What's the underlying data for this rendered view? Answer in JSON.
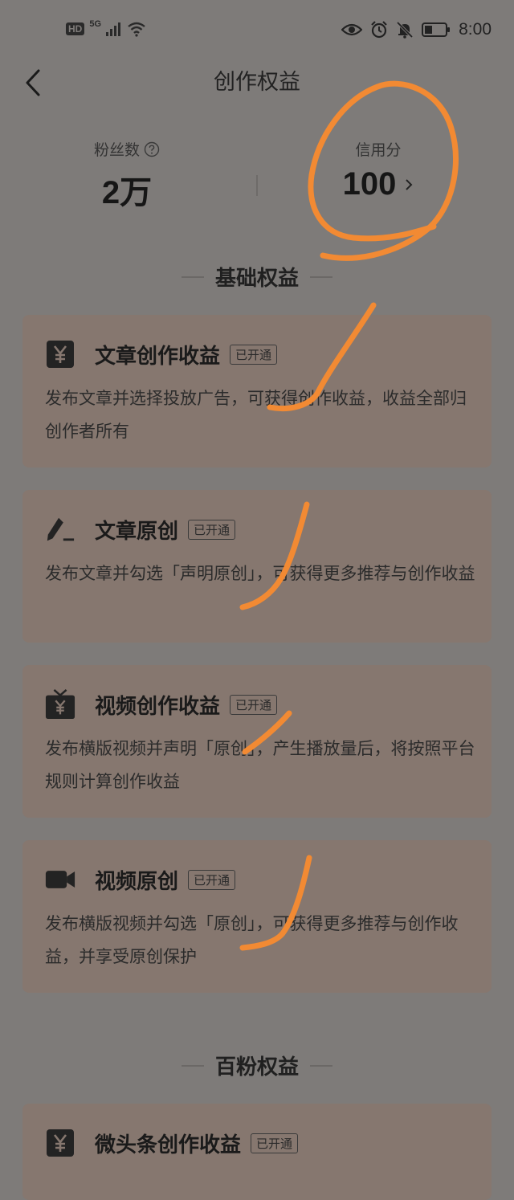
{
  "status_bar": {
    "hd": "HD",
    "signal": "5G",
    "time": "8:00"
  },
  "header": {
    "title": "创作权益"
  },
  "stats": {
    "fans": {
      "label": "粉丝数",
      "value": "2万"
    },
    "credit": {
      "label": "信用分",
      "value": "100"
    }
  },
  "sections": {
    "basic": {
      "title": "基础权益"
    },
    "hundred": {
      "title": "百粉权益"
    }
  },
  "cards": [
    {
      "title": "文章创作收益",
      "badge": "已开通",
      "desc": "发布文章并选择投放广告，可获得创作收益，收益全部归创作者所有"
    },
    {
      "title": "文章原创",
      "badge": "已开通",
      "desc": "发布文章并勾选「声明原创」，可获得更多推荐与创作收益"
    },
    {
      "title": "视频创作收益",
      "badge": "已开通",
      "desc": "发布横版视频并声明「原创」，产生播放量后，将按照平台规则计算创作收益"
    },
    {
      "title": "视频原创",
      "badge": "已开通",
      "desc": "发布横版视频并勾选「原创」，可获得更多推荐与创作收益，并享受原创保护"
    },
    {
      "title": "微头条创作收益",
      "badge": "已开通"
    }
  ],
  "icons": {
    "fans_help": "question-circle-icon",
    "credit_arrow": "chevron-right-icon",
    "card_icons": [
      "yuan-icon",
      "pen-icon",
      "tv-yuan-icon",
      "video-camera-icon",
      "yuan-icon"
    ]
  },
  "colors": {
    "background": "#7e7b79",
    "card": "#86776f",
    "annotation": "#f28a33"
  }
}
